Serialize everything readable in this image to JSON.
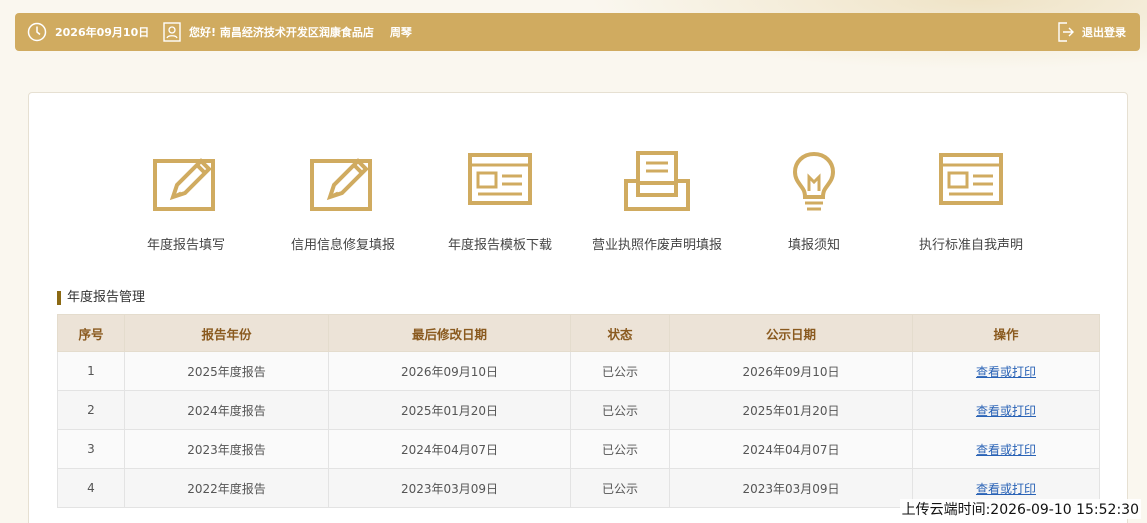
{
  "header": {
    "date": "2026年09月10日",
    "greeting": "您好! 南昌经济技术开发区润康食品店",
    "username": "周琴",
    "logout_label": "退出登录"
  },
  "features": [
    {
      "label": "年度报告填写",
      "icon": "edit-form-icon"
    },
    {
      "label": "信用信息修复填报",
      "icon": "edit-form-icon"
    },
    {
      "label": "年度报告模板下载",
      "icon": "template-window-icon"
    },
    {
      "label": "营业执照作废声明填报",
      "icon": "inbox-tray-icon"
    },
    {
      "label": "填报须知",
      "icon": "lightbulb-icon"
    },
    {
      "label": "执行标准自我声明",
      "icon": "template-window-icon"
    }
  ],
  "section_title": "年度报告管理",
  "table": {
    "columns": [
      "序号",
      "报告年份",
      "最后修改日期",
      "状态",
      "公示日期",
      "操作"
    ],
    "rows": [
      [
        "1",
        "2025年度报告",
        "2026年09月10日",
        "已公示",
        "2026年09月10日",
        "查看或打印"
      ],
      [
        "2",
        "2024年度报告",
        "2025年01月20日",
        "已公示",
        "2025年01月20日",
        "查看或打印"
      ],
      [
        "3",
        "2023年度报告",
        "2024年04月07日",
        "已公示",
        "2024年04月07日",
        "查看或打印"
      ],
      [
        "4",
        "2022年度报告",
        "2023年03月09日",
        "已公示",
        "2023年03月09日",
        "查看或打印"
      ]
    ]
  },
  "upload_time": "上传云端时间:2026-09-10 15:52:30",
  "colors": {
    "accent": "#d0ab60",
    "icon_gold": "#d0ab60",
    "header_text": "#8a5a1f",
    "link": "#2a63b6"
  }
}
